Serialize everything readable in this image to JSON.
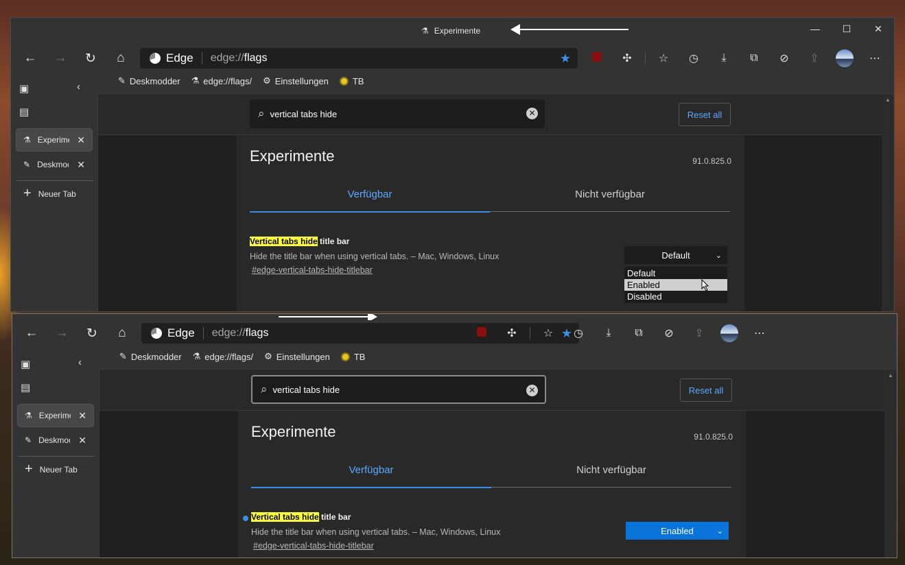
{
  "windows": [
    {
      "title": "Experimente",
      "address": {
        "brand": "Edge",
        "url_prefix": "edge://",
        "url_host": "flags"
      },
      "bookmarks": [
        "Deskmodder",
        "edge://flags/",
        "Einstellungen",
        "TB"
      ],
      "sidebar_tabs": [
        "Experimente",
        "Deskmodder"
      ],
      "new_tab": "Neuer Tab",
      "search_query": "vertical tabs hide",
      "reset_all": "Reset all",
      "page_title": "Experimente",
      "version": "91.0.825.0",
      "tab_available": "Verfügbar",
      "tab_unavailable": "Nicht verfügbar",
      "flag": {
        "title_highlight": "Vertical tabs hide",
        "title_rest": " title bar",
        "description": "Hide the title bar when using vertical tabs. – Mac, Windows, Linux",
        "link": "#edge-vertical-tabs-hide-titlebar"
      },
      "select_value": "Default",
      "dropdown_options": [
        "Default",
        "Enabled",
        "Disabled"
      ],
      "dropdown_hovered": "Enabled"
    },
    {
      "address": {
        "brand": "Edge",
        "url_prefix": "edge://",
        "url_host": "flags"
      },
      "bookmarks": [
        "Deskmodder",
        "edge://flags/",
        "Einstellungen",
        "TB"
      ],
      "sidebar_tabs": [
        "Experimente",
        "Deskmodder"
      ],
      "new_tab": "Neuer Tab",
      "search_query": "vertical tabs hide",
      "reset_all": "Reset all",
      "page_title": "Experimente",
      "version": "91.0.825.0",
      "tab_available": "Verfügbar",
      "tab_unavailable": "Nicht verfügbar",
      "flag": {
        "title_highlight": "Vertical tabs hide",
        "title_rest": " title bar",
        "description": "Hide the title bar when using vertical tabs. – Mac, Windows, Linux",
        "link": "#edge-vertical-tabs-hide-titlebar"
      },
      "select_value": "Enabled"
    }
  ],
  "colors": {
    "accent": "#3b8fe4",
    "link": "#5ea8ff",
    "highlight": "#ffff3b",
    "select_enabled": "#0a74da"
  },
  "icons": [
    "flask-icon",
    "back-icon",
    "forward-icon",
    "refresh-icon",
    "home-icon",
    "star-icon",
    "ublock-icon",
    "extensions-icon",
    "favorites-icon",
    "history-icon",
    "downloads-icon",
    "collections-icon",
    "performance-icon",
    "share-icon",
    "profile-avatar",
    "more-icon",
    "search-icon",
    "clear-icon",
    "chevron-down-icon",
    "minimize-icon",
    "maximize-icon",
    "close-icon"
  ]
}
